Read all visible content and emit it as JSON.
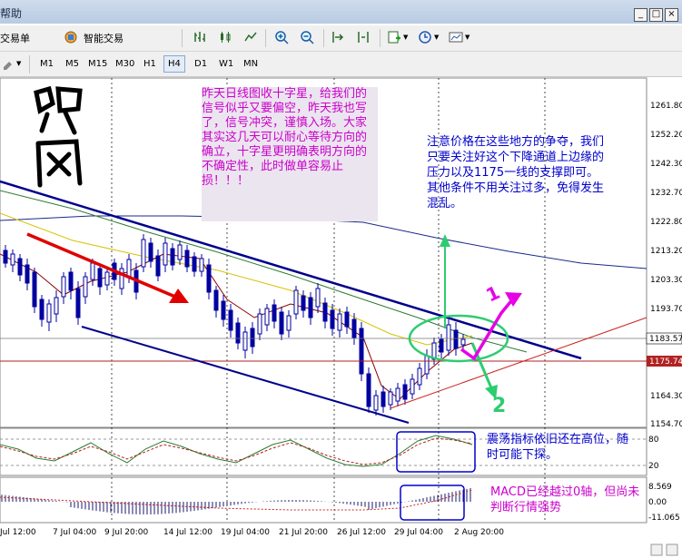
{
  "window": {
    "title_fragment": "帮助",
    "controls": [
      "_",
      "□",
      "×"
    ]
  },
  "toolbar": {
    "order_label": "交易单",
    "expert_label": "智能交易",
    "timeframes": [
      "M1",
      "M5",
      "M15",
      "M30",
      "H1",
      "H4",
      "D1",
      "W1",
      "MN"
    ],
    "active_timeframe": "H4"
  },
  "price_axis": {
    "ticks": [
      "1261.80",
      "1252.20",
      "1242.30",
      "1232.70",
      "1222.80",
      "1213.20",
      "1203.30",
      "1193.70",
      "1183.57",
      "1175.74",
      "1164.30",
      "1154.70"
    ],
    "current_price": "1183.57",
    "marked_price": "1175.74"
  },
  "oscillator_axis": {
    "ticks": [
      "80",
      "20"
    ]
  },
  "macd_axis": {
    "ticks": [
      "8.569",
      "0.00",
      "-11.065"
    ]
  },
  "time_axis": [
    "Jul 12:00",
    "7 Jul 04:00",
    "9 Jul 20:00",
    "14 Jul 12:00",
    "19 Jul 04:00",
    "21 Jul 20:00",
    "26 Jul 12:00",
    "29 Jul 04:00",
    "2 Aug 20:00"
  ],
  "annotations": {
    "calligraphy": "观风",
    "note_left": "昨天日线图收十字星，给我们的信号似乎又要偏空，昨天我也写了，信号冲突，谨慎入场。大家其实这几天可以耐心等待方向的确立，十字星更明确表明方向的不确定性，此时做单容易止损！！！",
    "note_right": "注意价格在这些地方的争夺，我们只要关注好这个下降通道上边缘的压力以及1175一线的支撑即可。其他条件不用关注过多，免得发生混乱。",
    "note_oscillator": "震荡指标依旧还在高位，随时可能下探。",
    "note_macd": "MACD已经越过0轴，但尚未判断行情强势",
    "arrow_up_label": "1",
    "arrow_down_label": "2"
  },
  "colors": {
    "note_purple": "#cc00cc",
    "note_blue": "#0000cc",
    "candle_blue": "#0000a0",
    "channel": "#00008b",
    "trend_red": "#e00000",
    "arrow_green": "#2ecc71",
    "arrow_magenta": "#e600e6"
  }
}
